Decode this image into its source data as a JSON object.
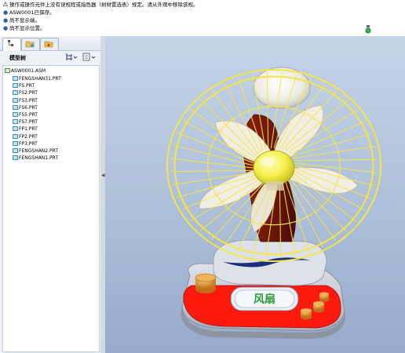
{
  "messages": [
    {
      "icon": "warning-icon",
      "text": "操作或操作元件上没有误规程或指色器（树材置选表）规定。请从外观中移除该规。"
    },
    {
      "icon": "info-icon",
      "text": "ASW0001已保存。"
    },
    {
      "icon": "info-icon",
      "text": "尚不显示端。"
    },
    {
      "icon": "info-icon",
      "text": "尚不显示位置。"
    }
  ],
  "model_tree": {
    "title": "模型树",
    "root": "ASW0001.ASM",
    "items": [
      "FENGSHAN31.PRT",
      "FS.PRT",
      "FS2.PRT",
      "FS3.PRT",
      "FS6.PRT",
      "FS5.PRT",
      "FS7.PRT",
      "FP1.PRT",
      "FP2.PRT",
      "FP3.PRT",
      "FENGSHAN2.PRT",
      "FENGSHAN1.PRT"
    ]
  },
  "viewport": {
    "base_label": "风扇",
    "colors": {
      "cage": "#f2e64a",
      "hub": "#f5f04a",
      "blades": "#f2eee4",
      "stand": "#6b1508",
      "base_top": "#ff1a0f",
      "base_body": "#c9ced6",
      "knob": "#e08c1e",
      "background": "#b9c8df"
    }
  },
  "status": {
    "light_color": "#2db24a"
  }
}
